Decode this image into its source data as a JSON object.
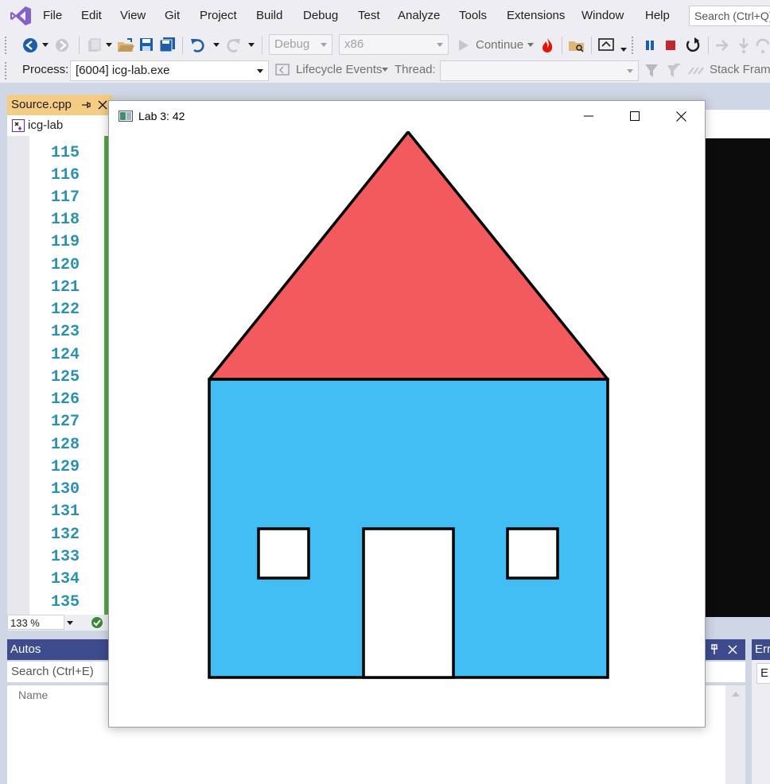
{
  "menu": {
    "items": [
      "File",
      "Edit",
      "View",
      "Git",
      "Project",
      "Build",
      "Debug",
      "Test",
      "Analyze",
      "Tools",
      "Extensions",
      "Window",
      "Help"
    ],
    "search_placeholder": "Search (Ctrl+Q)"
  },
  "toolbar": {
    "config_value": "Debug",
    "platform_value": "x86",
    "continue_label": "Continue"
  },
  "debug_location": {
    "process_label": "Process:",
    "process_value": "[6004] icg-lab.exe",
    "lifecycle_label": "Lifecycle Events",
    "thread_label": "Thread:",
    "stack_frame_label": "Stack Frame"
  },
  "editor": {
    "tab_label": "Source.cpp",
    "nav_project": "icg-lab",
    "line_numbers": [
      "115",
      "116",
      "117",
      "118",
      "119",
      "120",
      "121",
      "122",
      "123",
      "124",
      "125",
      "126",
      "127",
      "128",
      "129",
      "130",
      "131",
      "132",
      "133",
      "134",
      "135"
    ],
    "zoom": "133 %"
  },
  "autos": {
    "title": "Autos",
    "search_placeholder": "Search (Ctrl+E)",
    "column_name": "Name"
  },
  "error_panel": {
    "title_fragment": "Err",
    "search_fragment": "E"
  },
  "app_window": {
    "title": "Lab 3: 42"
  },
  "drawing": {
    "roof_color": "#f25a5e",
    "house_color": "#42bef5",
    "outline_color": "#000000",
    "window_color": "#ffffff",
    "door_color": "#ffffff"
  }
}
